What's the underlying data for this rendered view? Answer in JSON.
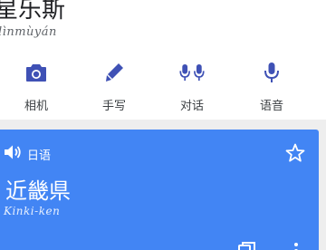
{
  "input": {
    "text": "星乐斯",
    "pinyin": "lìnmùyán"
  },
  "tools": [
    {
      "label": "相机",
      "icon": "camera-icon"
    },
    {
      "label": "手写",
      "icon": "handwriting-pen-icon"
    },
    {
      "label": "对话",
      "icon": "conversation-mic-icon"
    },
    {
      "label": "语音",
      "icon": "voice-mic-icon"
    }
  ],
  "result": {
    "language": "日语",
    "text": "近畿県",
    "romanization": "Kinki-ken"
  },
  "colors": {
    "accent": "#3f51b5",
    "card": "#4285f4",
    "page_bg": "#eeeeee"
  }
}
